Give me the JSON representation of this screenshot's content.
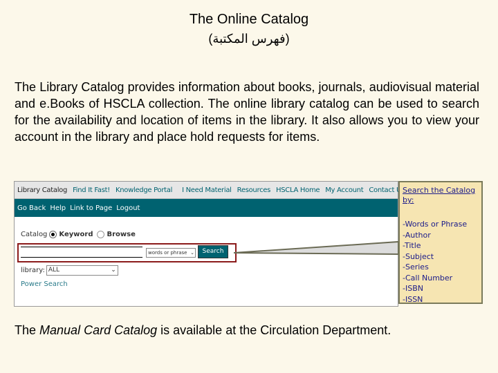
{
  "title": "The Online Catalog",
  "subtitle": "(فهرس المكتبة)",
  "intro": "The Library Catalog provides information about books, journals, audiovisual material and e.Books of HSCLA collection. The online library catalog can be used to search for the availability and location of items in the library. It also allows you to view your account in the library and place hold requests for items.",
  "nav_top": [
    "Library Catalog",
    "Find It Fast!",
    "Knowledge Portal",
    "I Need Material",
    "Resources",
    "HSCLA Home",
    "My Account",
    "Contact Us"
  ],
  "nav_sub": [
    "Go Back",
    "Help",
    "Link to Page",
    "Logout"
  ],
  "search": {
    "catalog_label": "Catalog",
    "keyword": "Keyword",
    "browse": "Browse",
    "selected": "Keyword",
    "query": "",
    "type_option": "words or phrase",
    "button": "Search",
    "library_label": "library:",
    "library_value": "ALL",
    "power_search": "Power Search"
  },
  "callout": {
    "heading": "Search the Catalog by:",
    "items": [
      "-Words or Phrase",
      "-Author",
      "-Title",
      "-Subject",
      "-Series",
      "-Call Number",
      "-ISBN",
      "-ISSN"
    ]
  },
  "footer": {
    "pre": "The ",
    "em": "Manual Card Catalog",
    "post": " is available at the Circulation Department."
  }
}
